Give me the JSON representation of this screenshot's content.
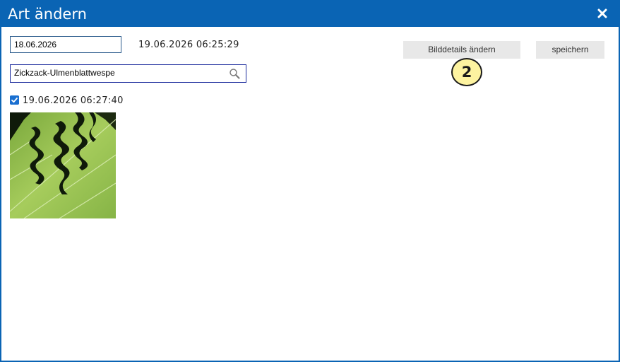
{
  "dialog": {
    "title": "Art ändern",
    "close_icon": "close-icon"
  },
  "form": {
    "date_value": "18.06.2026",
    "recorded_timestamp": "19.06.2026 06:25:29",
    "species_value": "Zickzack-Ulmenblattwespe",
    "search_icon": "search-icon"
  },
  "buttons": {
    "details_label": "Bilddetails ändern",
    "save_label": "speichern"
  },
  "annotation": {
    "badge_number": "2"
  },
  "image_entry": {
    "checked": true,
    "timestamp": "19.06.2026 06:27:40",
    "thumbnail_icon": "leaf-photo"
  },
  "colors": {
    "titlebar": "#0a64b4",
    "badge_fill": "#fdf3a0",
    "checkbox": "#1a6fd0",
    "button_bg": "#e8e8e8"
  }
}
